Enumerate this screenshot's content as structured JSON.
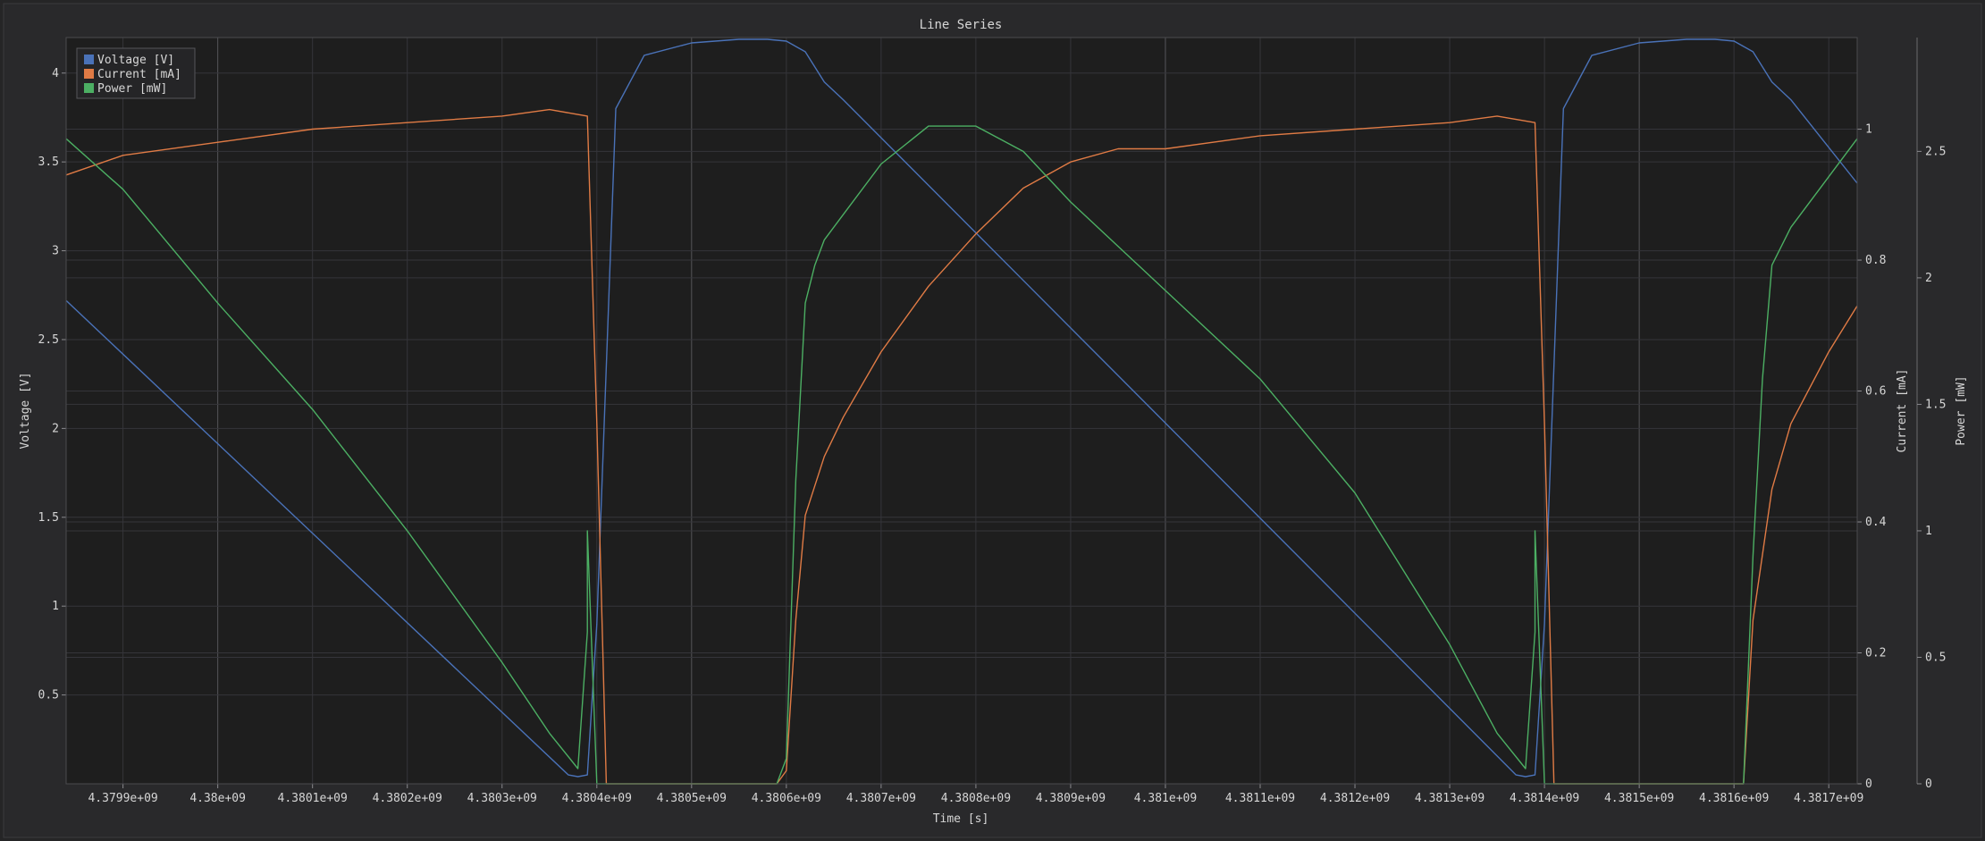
{
  "window": {
    "bg": "#252526",
    "plot_bg": "#1e1e1e",
    "frame": "#3a3a3e"
  },
  "chart_data": {
    "type": "line",
    "title": "Line Series",
    "xlabel": "Time [s]",
    "xlim": [
      4379840000.0,
      4381730000.0
    ],
    "x_tick_labels": [
      "4.3799e+09",
      "4.38e+09",
      "4.3801e+09",
      "4.3802e+09",
      "4.3803e+09",
      "4.3804e+09",
      "4.3805e+09",
      "4.3806e+09",
      "4.3807e+09",
      "4.3808e+09",
      "4.3809e+09",
      "4.381e+09",
      "4.3811e+09",
      "4.3812e+09",
      "4.3813e+09",
      "4.3814e+09",
      "4.3815e+09",
      "4.3816e+09",
      "4.3817e+09"
    ],
    "x_tick_values": [
      4379900000.0,
      4380000000.0,
      4380100000.0,
      4380200000.0,
      4380300000.0,
      4380400000.0,
      4380500000.0,
      4380600000.0,
      4380700000.0,
      4380800000.0,
      4380900000.0,
      4381000000.0,
      4381100000.0,
      4381200000.0,
      4381300000.0,
      4381400000.0,
      4381500000.0,
      4381600000.0,
      4381700000.0
    ],
    "axes": [
      {
        "id": "voltage",
        "label": "Voltage [V]",
        "side": "left",
        "ylim": [
          0.0,
          4.2
        ],
        "ticks": [
          0.5,
          1,
          1.5,
          2,
          2.5,
          3,
          3.5,
          4
        ],
        "tick_labels": [
          "0.5",
          "1",
          "1.5",
          "2",
          "2.5",
          "3",
          "3.5",
          "4"
        ]
      },
      {
        "id": "current",
        "label": "Current [mA]",
        "side": "right",
        "ylim": [
          0.0,
          1.14
        ],
        "ticks": [
          0,
          0.2,
          0.4,
          0.6,
          0.8,
          1
        ],
        "tick_labels": [
          "0",
          "0.2",
          "0.4",
          "0.6",
          "0.8",
          "1"
        ]
      },
      {
        "id": "power",
        "label": "Power [mW]",
        "side": "right-outer",
        "ylim": [
          0.0,
          2.95
        ],
        "ticks": [
          0,
          0.5,
          1,
          1.5,
          2,
          2.5
        ],
        "tick_labels": [
          "0",
          "0.5",
          "1",
          "1.5",
          "2",
          "2.5"
        ]
      }
    ],
    "legend": {
      "placement": "top-left"
    },
    "grid": true,
    "series": [
      {
        "name": "Voltage [V]",
        "axis": "voltage",
        "color": "#4a72b8",
        "x": [
          4379840000.0,
          4380370000.0,
          4380380000.0,
          4380390000.0,
          4380400000.0,
          4380420000.0,
          4380450000.0,
          4380500000.0,
          4380550000.0,
          4380580000.0,
          4380600000.0,
          4380620000.0,
          4380640000.0,
          4380660000.0,
          4381370000.0,
          4381380000.0,
          4381390000.0,
          4381400000.0,
          4381420000.0,
          4381450000.0,
          4381500000.0,
          4381550000.0,
          4381580000.0,
          4381600000.0,
          4381620000.0,
          4381640000.0,
          4381660000.0,
          4381730000.0
        ],
        "y": [
          2.72,
          0.05,
          0.04,
          0.05,
          0.9,
          3.8,
          4.1,
          4.17,
          4.19,
          4.19,
          4.18,
          4.12,
          3.95,
          3.85,
          0.05,
          0.04,
          0.05,
          0.9,
          3.8,
          4.1,
          4.17,
          4.19,
          4.19,
          4.18,
          4.12,
          3.95,
          3.85,
          3.38
        ]
      },
      {
        "name": "Current [mA]",
        "axis": "current",
        "color": "#e07b45",
        "x": [
          4379840000.0,
          4379900000.0,
          4380000000.0,
          4380100000.0,
          4380200000.0,
          4380300000.0,
          4380350000.0,
          4380390000.0,
          4380400000.0,
          4380410000.0,
          4380450000.0,
          4380500000.0,
          4380590000.0,
          4380600000.0,
          4380610000.0,
          4380620000.0,
          4380640000.0,
          4380660000.0,
          4380700000.0,
          4380750000.0,
          4380800000.0,
          4380850000.0,
          4380900000.0,
          4380950000.0,
          4381000000.0,
          4381100000.0,
          4381200000.0,
          4381300000.0,
          4381350000.0,
          4381390000.0,
          4381400000.0,
          4381410000.0,
          4381450000.0,
          4381500000.0,
          4381610000.0,
          4381620000.0,
          4381640000.0,
          4381660000.0,
          4381700000.0,
          4381730000.0
        ],
        "y": [
          0.93,
          0.96,
          0.98,
          1.0,
          1.01,
          1.02,
          1.03,
          1.02,
          0.55,
          0.0,
          0.0,
          0.0,
          0.0,
          0.02,
          0.25,
          0.41,
          0.5,
          0.56,
          0.66,
          0.76,
          0.84,
          0.91,
          0.95,
          0.97,
          0.97,
          0.99,
          1.0,
          1.01,
          1.02,
          1.01,
          0.55,
          0.0,
          0.0,
          0.0,
          0.0,
          0.25,
          0.45,
          0.55,
          0.66,
          0.73
        ]
      },
      {
        "name": "Power [mW]",
        "axis": "power",
        "color": "#4caf63",
        "x": [
          4379840000.0,
          4379900000.0,
          4380000000.0,
          4380100000.0,
          4380200000.0,
          4380300000.0,
          4380350000.0,
          4380380000.0,
          4380390000.0,
          4380390000.0,
          4380400000.0,
          4380410000.0,
          4380590000.0,
          4380600000.0,
          4380610000.0,
          4380620000.0,
          4380630000.0,
          4380640000.0,
          4380660000.0,
          4380700000.0,
          4380750000.0,
          4380800000.0,
          4380850000.0,
          4380900000.0,
          4381000000.0,
          4381100000.0,
          4381200000.0,
          4381300000.0,
          4381350000.0,
          4381380000.0,
          4381390000.0,
          4381390000.0,
          4381400000.0,
          4381410000.0,
          4381610000.0,
          4381620000.0,
          4381630000.0,
          4381640000.0,
          4381660000.0,
          4381700000.0,
          4381730000.0
        ],
        "y": [
          2.55,
          2.35,
          1.9,
          1.48,
          1.0,
          0.48,
          0.2,
          0.06,
          0.6,
          1.0,
          0.0,
          0.0,
          0.0,
          0.1,
          1.2,
          1.9,
          2.05,
          2.15,
          2.25,
          2.45,
          2.6,
          2.6,
          2.5,
          2.3,
          1.95,
          1.6,
          1.15,
          0.55,
          0.2,
          0.06,
          0.6,
          1.0,
          0.0,
          0.0,
          0.0,
          0.9,
          1.6,
          2.05,
          2.2,
          2.4,
          2.55
        ]
      }
    ]
  }
}
